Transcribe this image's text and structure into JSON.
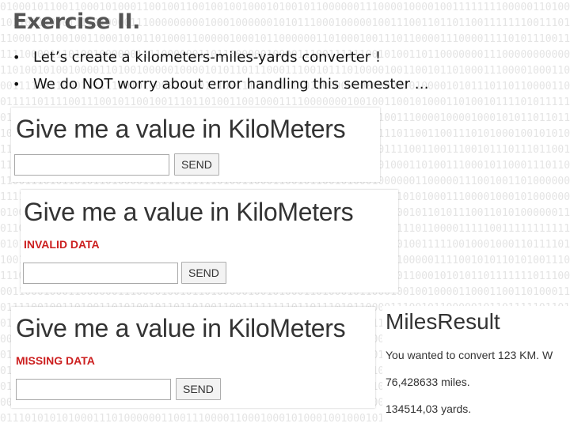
{
  "slide": {
    "title": "Exercise II.",
    "bullets": [
      "Let’s create a kilometers-miles-yards converter !",
      "We do NOT worry about error handling this semester …"
    ],
    "bullet_symbol": "•"
  },
  "panels": {
    "normal": {
      "heading": "Give me a value in KiloMeters",
      "input_value": "",
      "button_label": "SEND"
    },
    "invalid": {
      "heading": "Give me a value in KiloMeters",
      "error": "INVALID DATA",
      "input_value": "",
      "button_label": "SEND"
    },
    "missing": {
      "heading": "Give me a value in KiloMeters",
      "error": "MISSING DATA",
      "input_value": "",
      "button_label": "SEND"
    }
  },
  "result": {
    "heading": "MilesResult",
    "conversion_line": "You wanted to convert 123 KM. W",
    "miles_line": "76,428633 miles.",
    "yards_line": "134514,03 yards."
  },
  "colors": {
    "error_text": "#cc1f1f",
    "title_text": "#555555",
    "background_pattern": "#e4e4e4"
  }
}
